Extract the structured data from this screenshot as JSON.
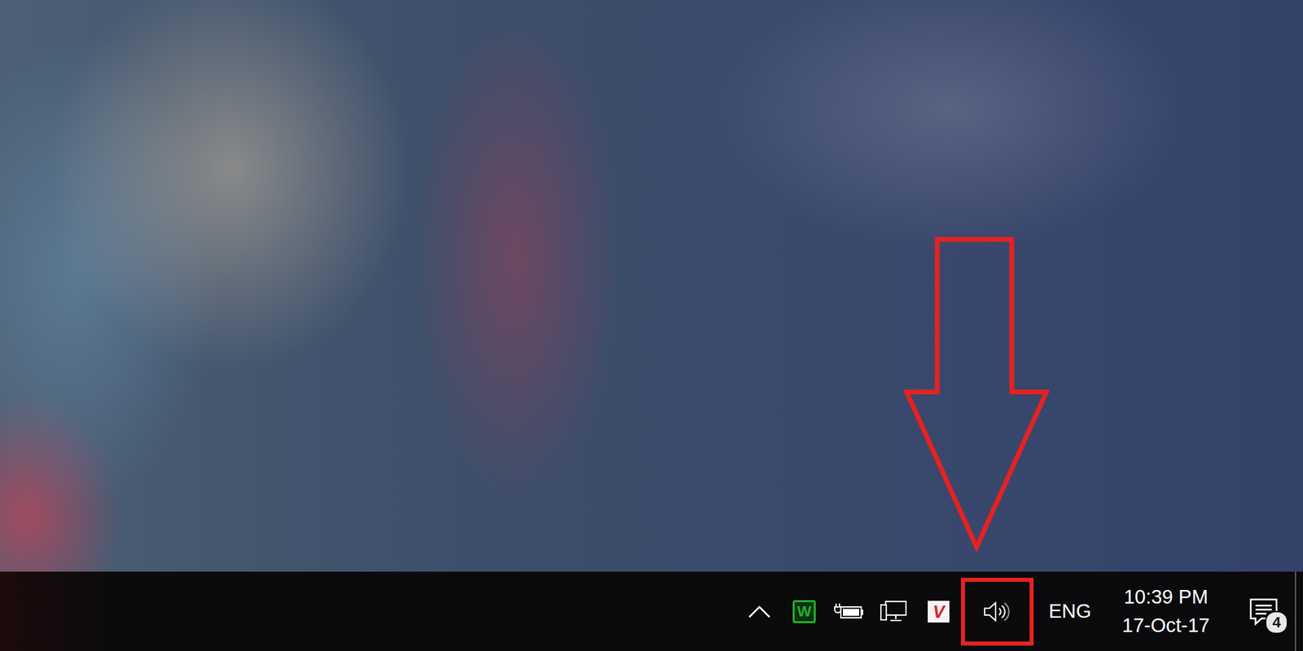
{
  "desktop": {
    "wallpaper": "photo"
  },
  "annotation": {
    "visible": true
  },
  "taskbar": {
    "tray_icons": [
      {
        "kind": "chevron",
        "highlighted": false
      },
      {
        "kind": "app-badge",
        "label": "W",
        "color": "#22b02c",
        "highlighted": false
      },
      {
        "kind": "battery",
        "highlighted": false
      },
      {
        "kind": "network",
        "highlighted": false
      },
      {
        "kind": "antivirus",
        "label": "V",
        "color": "#d8232a",
        "highlighted": false
      },
      {
        "kind": "volume",
        "highlighted": true
      }
    ],
    "language": "ENG",
    "clock": {
      "time": "10:39 PM",
      "date": "17-Oct-17"
    },
    "notifications": {
      "count": "4"
    }
  }
}
